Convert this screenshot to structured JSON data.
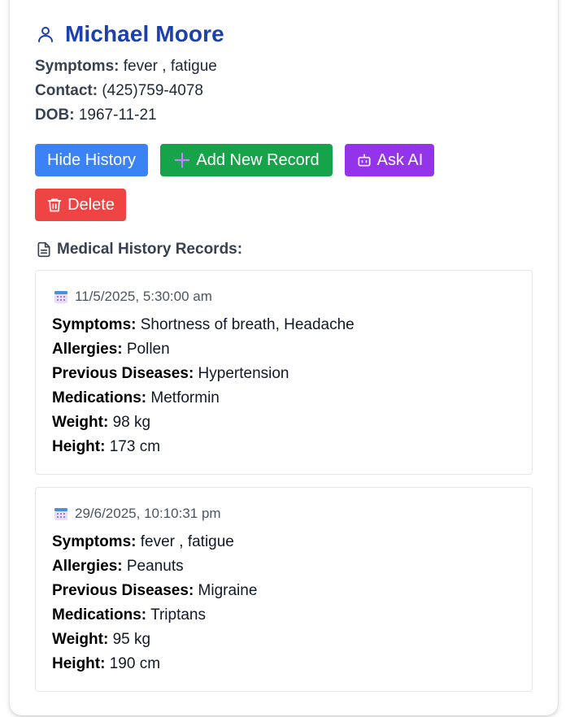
{
  "patient": {
    "name": "Michael Moore",
    "symptoms_label": "Symptoms:",
    "symptoms": "fever , fatigue",
    "contact_label": "Contact:",
    "contact": "(425)759-4078",
    "dob_label": "DOB:",
    "dob": "1967-11-21"
  },
  "actions": {
    "hide_history": "Hide History",
    "add_record": "Add New Record",
    "ask_ai": "Ask AI",
    "delete": "Delete"
  },
  "history": {
    "title": "Medical History Records:",
    "labels": {
      "symptoms": "Symptoms:",
      "allergies": "Allergies:",
      "previous_diseases": "Previous Diseases:",
      "medications": "Medications:",
      "weight": "Weight:",
      "height": "Height:"
    },
    "records": [
      {
        "date": "11/5/2025, 5:30:00 am",
        "symptoms": "Shortness of breath, Headache",
        "allergies": "Pollen",
        "previous_diseases": "Hypertension",
        "medications": "Metformin",
        "weight": "98 kg",
        "height": "173 cm"
      },
      {
        "date": "29/6/2025, 10:10:31 pm",
        "symptoms": "fever , fatigue",
        "allergies": "Peanuts",
        "previous_diseases": "Migraine",
        "medications": "Triptans",
        "weight": "95 kg",
        "height": "190 cm"
      }
    ]
  },
  "icons": {
    "header": "user-icon",
    "add": "plus-icon",
    "ask": "bot-icon",
    "delete": "trash-icon",
    "section": "file-text-icon",
    "date": "calendar-icon"
  },
  "colors": {
    "name": "#1e40af",
    "hide_history": "#3b82f6",
    "add_record": "#16a34a",
    "ask_ai": "#9333ea",
    "delete": "#ef4444"
  }
}
